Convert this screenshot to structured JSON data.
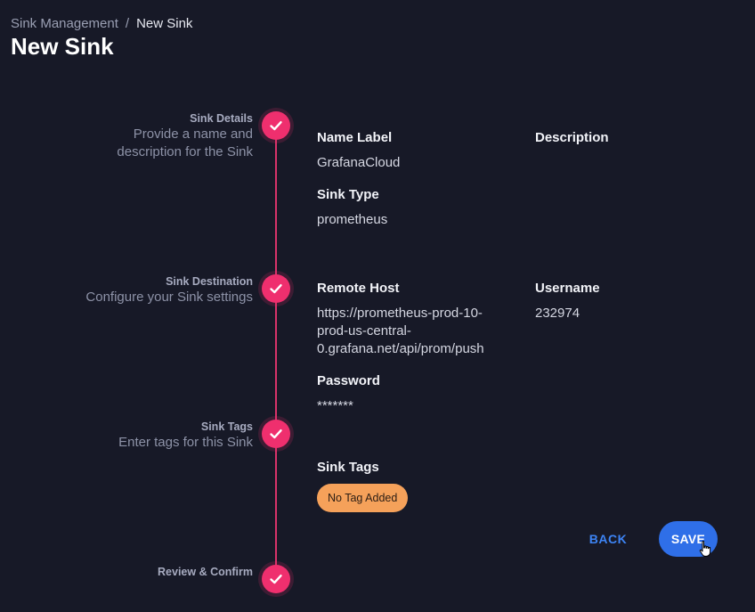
{
  "breadcrumb": {
    "parent": "Sink Management",
    "separator": "/",
    "current": "New Sink"
  },
  "page": {
    "title": "New Sink"
  },
  "steps": [
    {
      "title": "Sink Details",
      "description_lines": [
        "Provide a name and",
        "description for the Sink"
      ],
      "status": "complete"
    },
    {
      "title": "Sink Destination",
      "description_lines": [
        "Configure your Sink settings"
      ],
      "status": "complete"
    },
    {
      "title": "Sink Tags",
      "description_lines": [
        "Enter tags for this Sink"
      ],
      "status": "complete"
    },
    {
      "title": "Review & Confirm",
      "description_lines": [],
      "status": "complete"
    }
  ],
  "details": {
    "name_label": {
      "label": "Name Label",
      "value": "GrafanaCloud"
    },
    "description": {
      "label": "Description",
      "value": ""
    },
    "sink_type": {
      "label": "Sink Type",
      "value": "prometheus"
    }
  },
  "destination": {
    "remote_host": {
      "label": "Remote Host",
      "value": "https://prometheus-prod-10-prod-us-central-0.grafana.net/api/prom/push"
    },
    "username": {
      "label": "Username",
      "value": "232974"
    },
    "password": {
      "label": "Password",
      "value": "*******"
    }
  },
  "tags": {
    "label": "Sink Tags",
    "empty_chip": "No Tag Added"
  },
  "actions": {
    "back_label": "BACK",
    "save_label": "SAVE"
  },
  "icons": {
    "step_status": "check-icon",
    "pointer": "hand-pointer-icon"
  },
  "colors": {
    "background": "#171927",
    "accent_pink": "#ef2f6e",
    "primary_blue": "#2f6fe8",
    "tag_orange": "#f5a15a"
  }
}
